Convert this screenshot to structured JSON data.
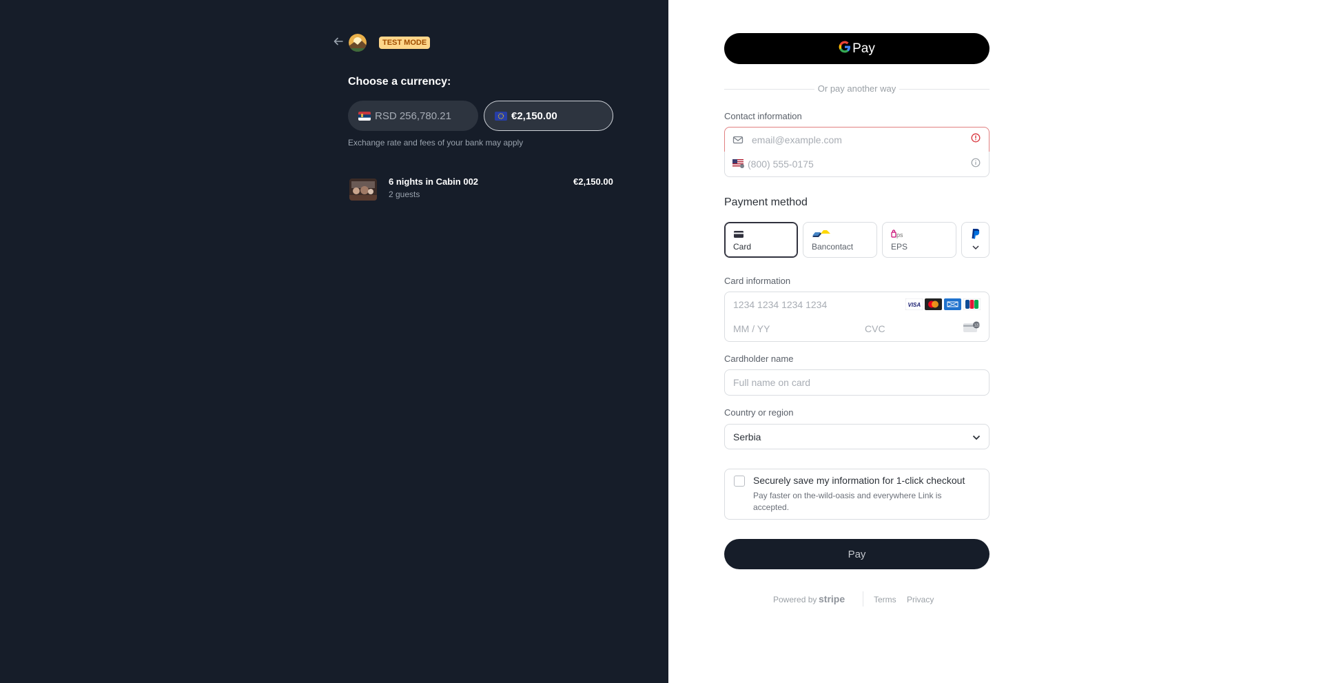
{
  "left": {
    "test_mode_badge": "TEST MODE",
    "choose_currency": "Choose a currency:",
    "currencies": [
      {
        "label": "RSD 256,780.21",
        "selected": false,
        "flag": "serbia-flag"
      },
      {
        "label": "€2,150.00",
        "selected": true,
        "flag": "eu-flag"
      }
    ],
    "exchange_note": "Exchange rate and fees of your bank may apply",
    "line_item": {
      "title": "6 nights in Cabin 002",
      "subtitle": "2 guests",
      "price": "€2,150.00"
    }
  },
  "right": {
    "gpay_label": "Pay",
    "or_pay": "Or pay another way",
    "contact_label": "Contact information",
    "email_placeholder": "email@example.com",
    "phone_placeholder": "(800) 555-0175",
    "payment_method_title": "Payment method",
    "payment_tabs": [
      {
        "label": "Card",
        "icon": "card-icon",
        "active": true
      },
      {
        "label": "Bancontact",
        "icon": "bancontact-icon",
        "active": false
      },
      {
        "label": "EPS",
        "icon": "eps-icon",
        "active": false
      }
    ],
    "more_methods_icon": "paypal-icon",
    "card_info_label": "Card information",
    "card_number_placeholder": "1234 1234 1234 1234",
    "card_brands": [
      "visa",
      "mastercard",
      "amex",
      "jcb"
    ],
    "expiry_placeholder": "MM / YY",
    "cvc_placeholder": "CVC",
    "cardholder_label": "Cardholder name",
    "cardholder_placeholder": "Full name on card",
    "country_label": "Country or region",
    "country_value": "Serbia",
    "save_title": "Securely save my information for 1-click checkout",
    "save_subtitle": "Pay faster on the-wild-oasis and everywhere Link is accepted.",
    "pay_button": "Pay",
    "footer": {
      "powered_by": "Powered by",
      "brand": "stripe",
      "terms": "Terms",
      "privacy": "Privacy"
    },
    "colors": {
      "left_bg": "#161d29",
      "error_border": "#e07f80",
      "badge_bg": "#ffd68a"
    }
  }
}
